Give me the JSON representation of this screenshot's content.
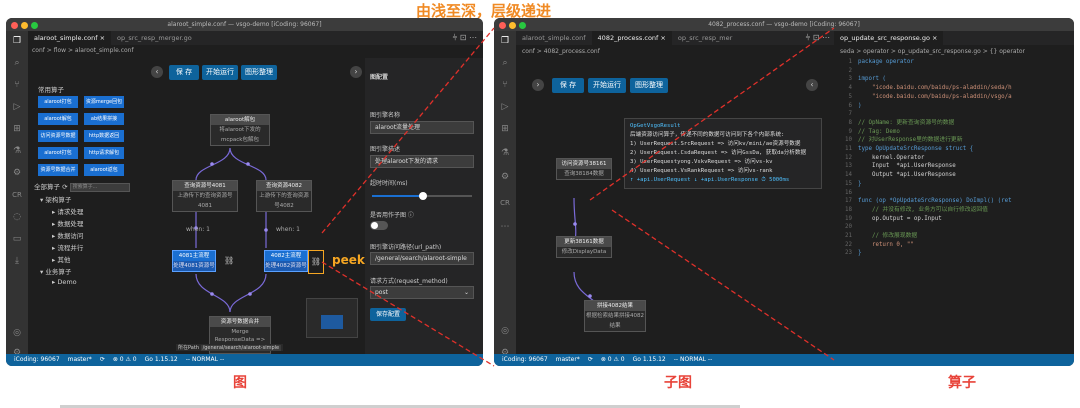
{
  "title": "由浅至深，层级递进",
  "captions": {
    "graph": "图",
    "subgraph": "子图",
    "operator": "算子"
  },
  "left": {
    "title": "alaroot_simple.conf — vsgo-demo [iCoding: 96067]",
    "tabs": [
      "alaroot_simple.conf ×",
      "op_src_resp_merger.go"
    ],
    "crumb": "conf > flow > alaroot_simple.conf",
    "toolbar": {
      "save": "保 存",
      "run": "开始运行",
      "arrange": "图形整理"
    },
    "ops_header": "常用算子",
    "ops": [
      "alaroot打包",
      "资源merge回包",
      "alaroot解包",
      "ab结果拼接",
      "访问资源号数据",
      "http数据返回",
      "alaroot打包",
      "http请求解包",
      "资源号数据合并",
      "alaroot返包"
    ],
    "tree_header": "全部算子",
    "tree_placeholder": "搜索算子...",
    "tree": [
      "▾ 架构算子",
      "▸ 请求处理",
      "▸ 数据处理",
      "▸ 数据访问",
      "▸ 流程并行",
      "▸ 其他",
      "▾ 业务算子",
      "▸ Demo"
    ],
    "nodes": [
      {
        "t": "alaroot解包",
        "s": "将alaroot下发的mcpack包解包"
      },
      {
        "t": "查询资源号4081",
        "s": "上游传下的查询资源号4081"
      },
      {
        "t": "查询资源4082",
        "s": "上游传下的查询资源号4082"
      },
      {
        "t": "4081主流程",
        "s": "处理4081资源号"
      },
      {
        "t": "4082主流程",
        "s": "处理4082资源号"
      },
      {
        "t": "资源号数据合并",
        "s": "Merge ResponseData => VsgoResponseData"
      }
    ],
    "when": "when: 1",
    "peek": "peek",
    "canvas_path": "所在Path",
    "canvas_path_value": "/general/search/alaroot-simple",
    "cfg": {
      "title": "图配置",
      "name_label": "图引擎名称",
      "name_value": "alaroot流量处理",
      "desc_label": "图引擎描述",
      "desc_value": "处理alaroot下发的请求",
      "timeout_label": "超时时间(ms)",
      "child_label": "是否用作子图 ⓘ",
      "path_label": "图引擎访问路径(url_path)",
      "path_value": "/general/search/alaroot-simple",
      "method_label": "请求方式(request_method)",
      "method_value": "post",
      "save": "保存配置"
    },
    "status": [
      "iCoding: 96067",
      "master*",
      "⟳",
      "⊗ 0 ⚠ 0",
      "Go 1.15.12",
      "-- NORMAL --"
    ]
  },
  "right": {
    "title": "4082_process.conf — vsgo-demo [iCoding: 96067]",
    "tabs": [
      "alaroot_simple.conf",
      "4082_process.conf ×",
      "op_src_resp_mer"
    ],
    "crumb": "conf > 4082_process.conf",
    "toolbar": {
      "save": "保 存",
      "run": "开始运行",
      "arrange": "图形整理"
    },
    "code_tab": "op_update_src_response.go ×",
    "code_crumb": "seda > operator > op_update_src_response.go > {} operator",
    "sub_nodes": [
      {
        "t": "访问资源号38161",
        "s": "查询38184数据"
      },
      {
        "t": "更新38161数据",
        "s": "修改DisplayData"
      },
      {
        "t": "拼接4082结果",
        "s": "根据检索结果拼接4082结果"
      }
    ],
    "tip_lines": [
      "OpGetVsgoResult",
      "后端资源访问算子，传递不同的数据可访问到下各个内部系统:",
      "1) UserRequest.SrcRequest => 访问kv/mini/ae资源号数据",
      "2) UserRequest.CsdaRequest => 访问GssDa, 获取da分析数据",
      "3) UserRequestyong.VskvRequest => 访问vs-kv",
      "4) UserRequest.VsRankRequest => 访问vs-rank",
      "↑ +api.UserRequest  ↓ +api.UserResponse  ⏱ 5000ms"
    ],
    "code": [
      "package operator",
      "",
      "import (",
      "    \"icode.baidu.com/baidu/ps-aladdin/seda/h",
      "    \"icode.baidu.com/baidu/ps-aladdin/vsgo/a",
      ")",
      "",
      "// OpName: 更新查询资源号的数据",
      "// Tag: Demo",
      "// 对UserResponse里的数据进行更新",
      "type OpUpdateSrcResponse struct {",
      "    kernel.Operator",
      "    Input  *api.UserResponse",
      "    Output *api.UserResponse",
      "}",
      "",
      "func (op *OpUpdateSrcResponse) DoImpl() (ret",
      "    // 并没有修改, 业务方可以自行修改返回值",
      "    op.Output = op.Input",
      "",
      "    // 修改展现数据",
      "    return 0, \"\"",
      "}"
    ],
    "status": [
      "iCoding: 96067",
      "master*",
      "⟳",
      "⊗ 0 ⚠ 0",
      "Go 1.15.12",
      "-- NORMAL --"
    ]
  },
  "colors": {
    "accent": "#0e639c",
    "op_blue": "#1a6fd1",
    "title_orange": "#f08a24",
    "caption_red": "#e8443a",
    "peek_orange": "#f5a623"
  },
  "icons": [
    "files-icon",
    "search-icon",
    "git-icon",
    "debug-icon",
    "extensions-icon",
    "test-icon",
    "remote-icon",
    "account-icon",
    "gear-icon"
  ]
}
